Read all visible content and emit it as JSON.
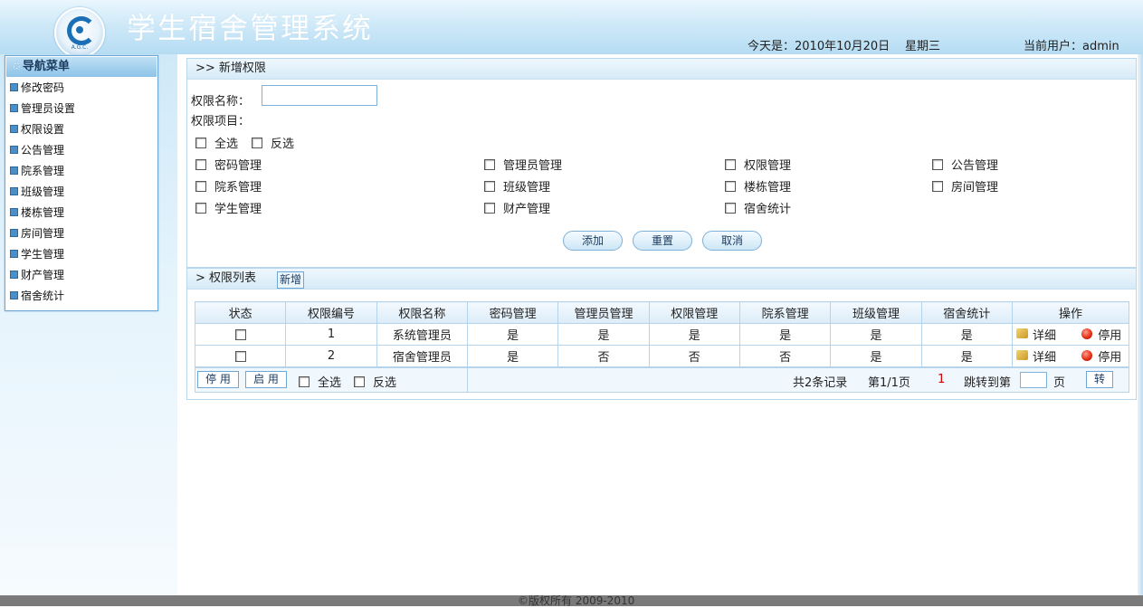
{
  "header": {
    "title": "学生宿舍管理系统",
    "logo_text": "A.G.C.",
    "date": "今天是：2010年10月20日",
    "weekday": "星期三",
    "user": "当前用户：admin"
  },
  "nav": {
    "title": "导航菜单",
    "items": [
      {
        "label": "修改密码"
      },
      {
        "label": "管理员设置"
      },
      {
        "label": "权限设置"
      },
      {
        "label": "公告管理"
      },
      {
        "label": "院系管理"
      },
      {
        "label": "班级管理"
      },
      {
        "label": "楼栋管理"
      },
      {
        "label": "房间管理"
      },
      {
        "label": "学生管理"
      },
      {
        "label": "财产管理"
      },
      {
        "label": "宿舍统计"
      }
    ]
  },
  "add_panel": {
    "title": ">> 新增权限",
    "name_label": "权限名称：",
    "name_value": "",
    "items_label": "权限项目：",
    "select_all": "全选",
    "invert": "反选",
    "perms": [
      "密码管理",
      "管理员管理",
      "权限管理",
      "公告管理",
      "院系管理",
      "班级管理",
      "楼栋管理",
      "房间管理",
      "学生管理",
      "财产管理",
      "宿舍统计"
    ],
    "add_btn": "添加",
    "reset_btn": "重置",
    "cancel_btn": "取消"
  },
  "list_panel": {
    "title": "> 权限列表",
    "new_btn": "新增",
    "columns": [
      "状态",
      "权限编号",
      "权限名称",
      "密码管理",
      "管理员管理",
      "权限管理",
      "院系管理",
      "班级管理",
      "宿舍统计",
      "操作"
    ],
    "rows": [
      {
        "id": "1",
        "name": "系统管理员",
        "pwd": "是",
        "admin": "是",
        "perm": "是",
        "dept": "是",
        "cls": "是",
        "stat": "是",
        "detail": "详细",
        "disable": "停用"
      },
      {
        "id": "2",
        "name": "宿舍管理员",
        "pwd": "是",
        "admin": "否",
        "perm": "否",
        "dept": "否",
        "cls": "是",
        "stat": "是",
        "detail": "详细",
        "disable": "停用"
      }
    ],
    "disable_btn": "停 用",
    "enable_btn": "启 用",
    "select_all": "全选",
    "invert": "反选",
    "total": "共2条记录",
    "page": "第1/1页",
    "page_link": "1",
    "jump_label": "跳转到第",
    "page_unit": "页",
    "go_btn": "转"
  },
  "footer": {
    "copyright": "©版权所有 2009-2010"
  }
}
